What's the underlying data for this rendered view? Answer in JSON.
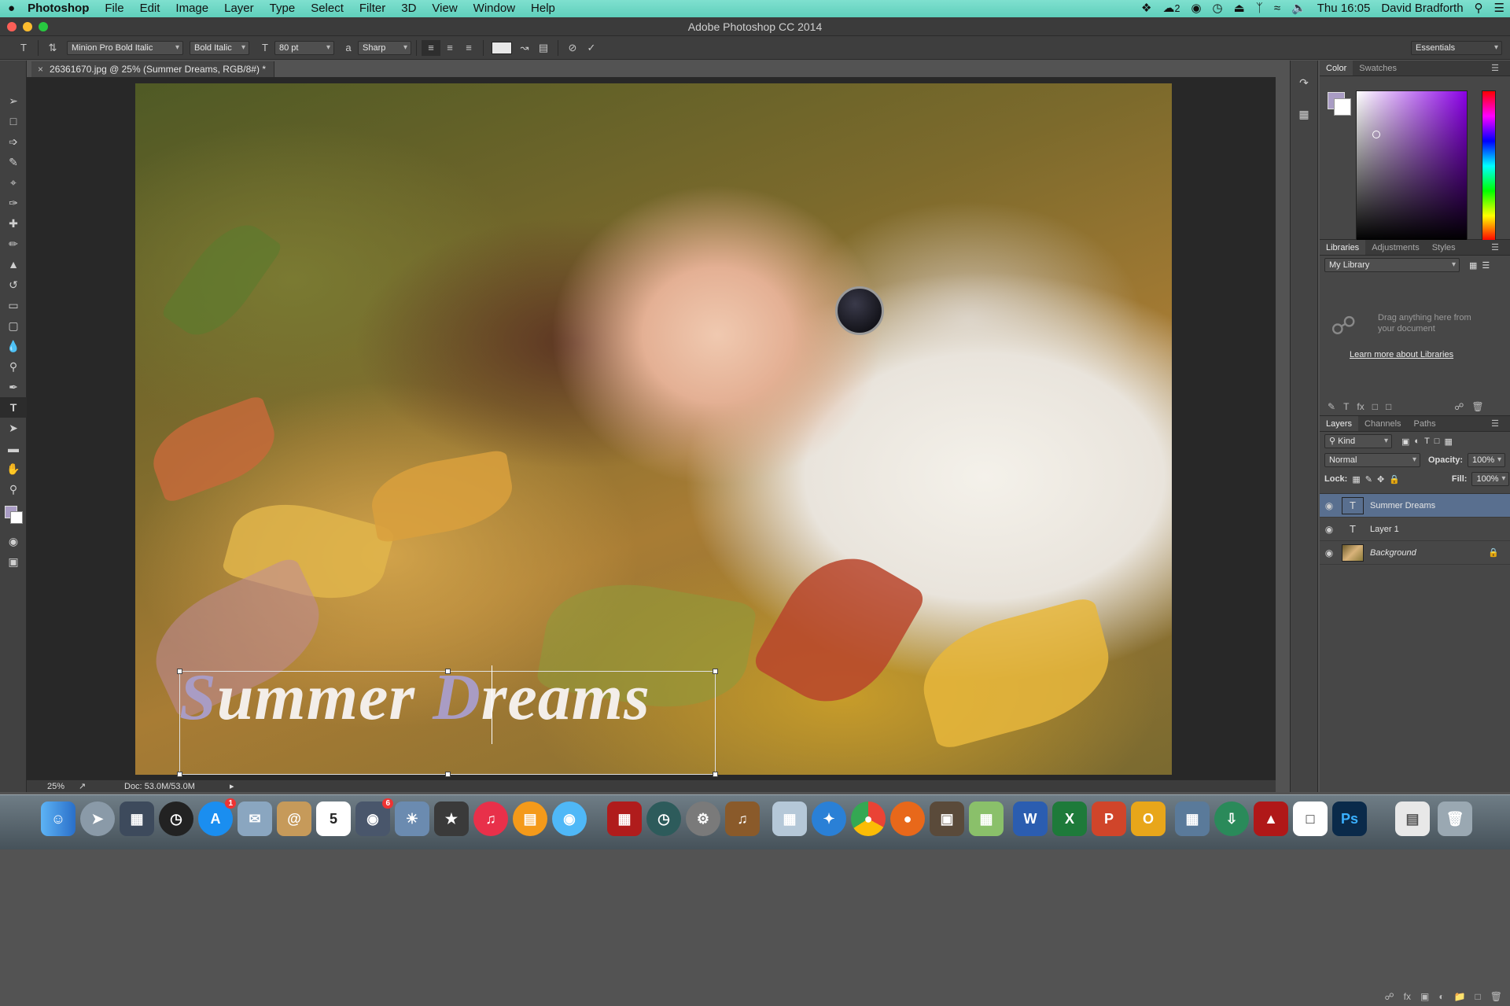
{
  "menubar": {
    "apple_icon": "apple-icon",
    "app_name": "Photoshop",
    "items": [
      "File",
      "Edit",
      "Image",
      "Layer",
      "Type",
      "Select",
      "Filter",
      "3D",
      "View",
      "Window",
      "Help"
    ],
    "badge_count": "2",
    "clock": "Thu 16:05",
    "user": "David Bradforth"
  },
  "window": {
    "title": "Adobe Photoshop CC 2014"
  },
  "options": {
    "font_family": "Minion Pro Bold Italic",
    "font_style": "Bold Italic",
    "font_size": "80 pt",
    "aa_label": "a",
    "antialias": "Sharp",
    "workspace": "Essentials"
  },
  "document": {
    "tab_title": "26361670.jpg @ 25% (Summer Dreams, RGB/8#) *",
    "typed_first_cap": "S",
    "typed_part1": "ummer ",
    "typed_second_cap": "D",
    "typed_part2": "reams",
    "zoom": "25%",
    "doc_size": "Doc: 53.0M/53.0M"
  },
  "colors": {
    "foreground": "#a99cc4",
    "background": "#ffffff",
    "selected_layer": "#596f8f"
  },
  "color_panel": {
    "tabs": [
      "Color",
      "Swatches"
    ]
  },
  "libraries_panel": {
    "tabs": [
      "Libraries",
      "Adjustments",
      "Styles"
    ],
    "library": "My Library",
    "hint": "Drag anything here from your document",
    "link": "Learn more about Libraries"
  },
  "layers_panel": {
    "tabs": [
      "Layers",
      "Channels",
      "Paths"
    ],
    "filter": "Kind",
    "blend_mode": "Normal",
    "opacity_label": "Opacity:",
    "opacity": "100%",
    "lock_label": "Lock:",
    "fill_label": "Fill:",
    "fill": "100%",
    "layers": [
      {
        "name": "Summer Dreams",
        "type": "T"
      },
      {
        "name": "Layer 1",
        "type": "T"
      },
      {
        "name": "Background",
        "type": "image"
      }
    ]
  },
  "dock": {
    "calendar_day": "5",
    "mail_badge": "6",
    "appstore_badge": "1",
    "word_letter": "W",
    "excel_letter": "X",
    "ppt_letter": "P",
    "outlook_letter": "O",
    "ps_letters": "Ps"
  }
}
